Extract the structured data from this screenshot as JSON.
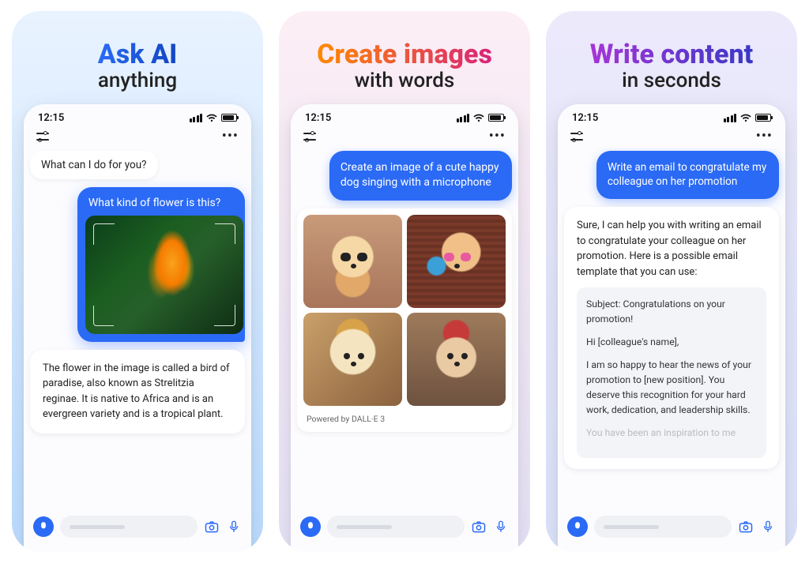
{
  "phone": {
    "time": "12:15"
  },
  "panels": [
    {
      "title_top": "Ask AI",
      "title_bottom": "anything",
      "ai_greeting": "What can I do for you?",
      "user_question": "What kind of flower is this?",
      "ai_answer": "The flower in the image is called a bird of paradise, also known as Strelitzia reginae. It is native to Africa and is an evergreen variety and is a tropical plant."
    },
    {
      "title_top": "Create images",
      "title_bottom": "with words",
      "user_prompt": "Create an image of a cute happy dog singing with a microphone",
      "powered_by": "Powered by DALL·E 3"
    },
    {
      "title_top": "Write content",
      "title_bottom": "in seconds",
      "user_prompt": "Write an email to congratulate my colleague on her promotion",
      "ai_intro": "Sure, I can help you with writing an email to congratulate your colleague on her promotion. Here is a possible email template that you can use:",
      "email": {
        "subject": "Subject: Congratulations on your promotion!",
        "greeting": "Hi [colleague's name],",
        "body": "I am so happy to hear the news of your promotion to [new position]. You deserve this recognition for your hard work, dedication, and leadership skills.",
        "faded": "You have been an inspiration to me"
      }
    }
  ]
}
